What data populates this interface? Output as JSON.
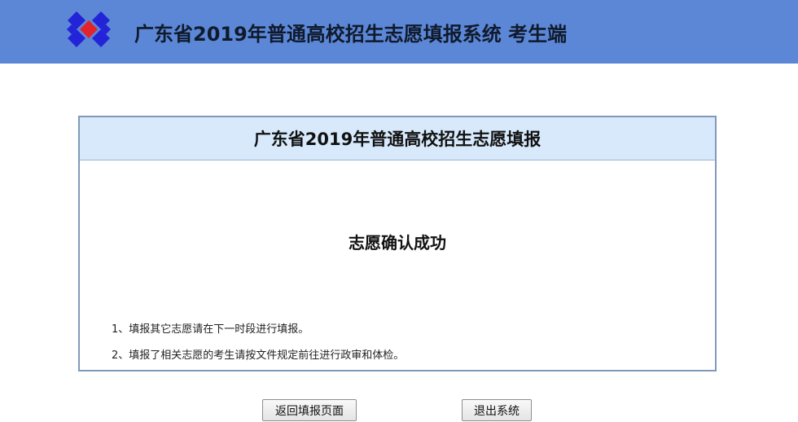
{
  "header": {
    "logo_icon": "diamond-grid-logo-icon",
    "title": "广东省2019年普通高校招生志愿填报系统  考生端",
    "background_color": "#5b87d6"
  },
  "panel": {
    "title": "广东省2019年普通高校招生志愿填报",
    "message": "志愿确认成功",
    "notes": [
      "1、填报其它志愿请在下一时段进行填报。",
      "2、填报了相关志愿的考生请按文件规定前往进行政审和体检。"
    ],
    "header_color": "#d7e9fb"
  },
  "actions": {
    "back_label": "返回填报页面",
    "exit_label": "退出系统"
  }
}
